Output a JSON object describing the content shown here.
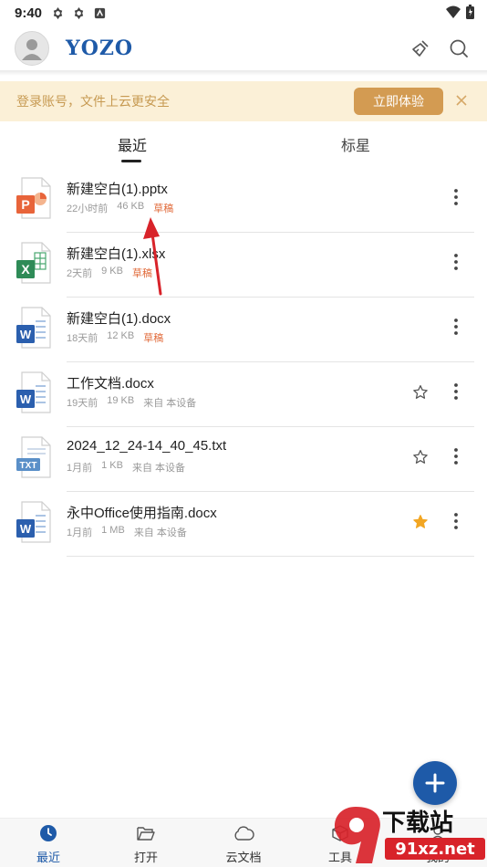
{
  "status_bar": {
    "time": "9:40"
  },
  "header": {
    "logo": "YOZO"
  },
  "banner": {
    "text": "登录账号，文件上云更安全",
    "button": "立即体验"
  },
  "tabs": [
    {
      "label": "最近"
    },
    {
      "label": "标星"
    }
  ],
  "files": [
    {
      "name": "新建空白(1).pptx",
      "time": "22小时前",
      "size": "46 KB",
      "tag": "草稿",
      "type": "pptx"
    },
    {
      "name": "新建空白(1).xlsx",
      "time": "2天前",
      "size": "9 KB",
      "tag": "草稿",
      "type": "xlsx"
    },
    {
      "name": "新建空白(1).docx",
      "time": "18天前",
      "size": "12 KB",
      "tag": "草稿",
      "type": "docx"
    },
    {
      "name": "工作文档.docx",
      "time": "19天前",
      "size": "19 KB",
      "source": "来自 本设备",
      "type": "docx",
      "starred": false
    },
    {
      "name": "2024_12_24-14_40_45.txt",
      "time": "1月前",
      "size": "1 KB",
      "source": "来自 本设备",
      "type": "txt",
      "starred": false
    },
    {
      "name": "永中Office使用指南.docx",
      "time": "1月前",
      "size": "1 MB",
      "source": "来自 本设备",
      "type": "docx",
      "starred": true
    }
  ],
  "bottom_nav": [
    {
      "label": "最近",
      "active": true
    },
    {
      "label": "打开"
    },
    {
      "label": "云文档"
    },
    {
      "label": "工具"
    },
    {
      "label": "我的"
    }
  ],
  "icons": {
    "file_icons": {
      "pptx": "#e8643a",
      "xlsx": "#2e8b57",
      "docx": "#2b5fae",
      "txt": "#5a8fc8"
    },
    "star_active": "#f2a623"
  },
  "watermark": {
    "title": "下载站",
    "url": "91xz.net"
  },
  "colors": {
    "accent": "#1e5aa8",
    "banner_bg": "#fbf0d7",
    "banner_button": "#d39b52",
    "draft": "#e16b3b"
  }
}
